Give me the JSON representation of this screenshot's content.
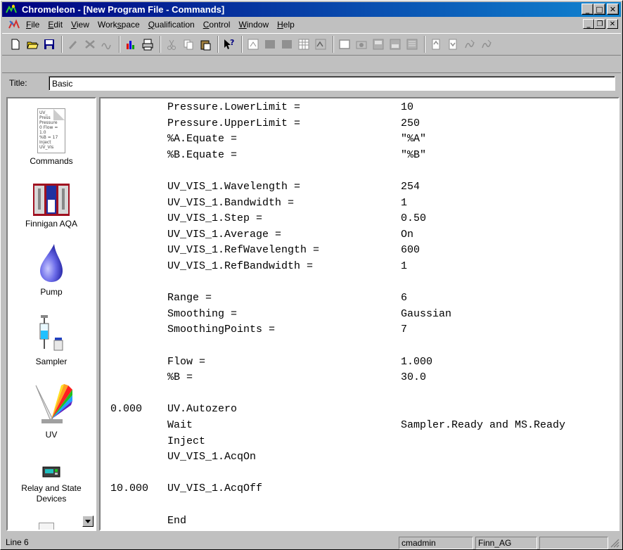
{
  "window": {
    "title": "Chromeleon - [New Program File - Commands]",
    "caption_buttons": [
      "_",
      "□",
      "✕"
    ],
    "mdi_buttons": [
      "_",
      "❐",
      "✕"
    ]
  },
  "menu": [
    {
      "label": "File",
      "u": "F",
      "rest": "ile"
    },
    {
      "label": "Edit",
      "u": "E",
      "rest": "dit"
    },
    {
      "label": "View",
      "u": "V",
      "rest": "iew"
    },
    {
      "label": "Workspace",
      "u": "W",
      "rest": "orkspace",
      "pre": "Work",
      "ul": "s",
      "post": "pace"
    },
    {
      "label": "Qualification",
      "u": "Q",
      "rest": "ualification"
    },
    {
      "label": "Control",
      "u": "C",
      "rest": "ontrol"
    },
    {
      "label": "Window",
      "u": "W",
      "rest": "indow"
    },
    {
      "label": "Help",
      "u": "H",
      "rest": "elp"
    }
  ],
  "toolbar": {
    "icons": [
      "new-icon",
      "open-icon",
      "save-icon",
      "sep",
      "edit-icon",
      "delete-icon",
      "signal-icon",
      "sep",
      "chart-icon",
      "print-icon",
      "sep",
      "cut-icon",
      "copy-icon",
      "paste-icon",
      "sep",
      "help-icon",
      "sep",
      "grid-icon",
      "filled-box-icon",
      "filled-box-icon-2",
      "table-icon",
      "image-icon",
      "sep",
      "frame-icon",
      "camera-icon",
      "panel-icon",
      "panel-icon-2",
      "panel-icon-3",
      "sep",
      "doc-up-icon",
      "doc-down-icon",
      "sign-icon",
      "sign-icon-2"
    ]
  },
  "title_field": {
    "label": "Title:",
    "value": "Basic"
  },
  "sidebar": {
    "items": [
      {
        "label": "Commands",
        "icon": "document-icon"
      },
      {
        "label": "Finnigan AQA",
        "icon": "mass-spec-icon"
      },
      {
        "label": "Pump",
        "icon": "droplet-icon"
      },
      {
        "label": "Sampler",
        "icon": "syringe-icon"
      },
      {
        "label": "UV",
        "icon": "uv-spectrum-icon"
      },
      {
        "label": "Relay and State\nDevices",
        "label1": "Relay and State",
        "label2": "Devices",
        "icon": "relay-icon"
      }
    ],
    "commands_thumb": [
      "UV_",
      "Press",
      "Pressure",
      "0 Flow = 1.0",
      "%B = 17",
      "Inject",
      "UV_Vis"
    ]
  },
  "editor": {
    "lines": [
      {
        "time": "",
        "cmd": "Pressure.LowerLimit =",
        "val": "10"
      },
      {
        "time": "",
        "cmd": "Pressure.UpperLimit =",
        "val": "250"
      },
      {
        "time": "",
        "cmd": "%A.Equate =",
        "val": "\"%A\""
      },
      {
        "time": "",
        "cmd": "%B.Equate =",
        "val": "\"%B\""
      },
      {
        "time": "",
        "cmd": "",
        "val": ""
      },
      {
        "time": "",
        "cmd": "UV_VIS_1.Wavelength =",
        "val": "254"
      },
      {
        "time": "",
        "cmd": "UV_VIS_1.Bandwidth =",
        "val": "1"
      },
      {
        "time": "",
        "cmd": "UV_VIS_1.Step =",
        "val": "0.50"
      },
      {
        "time": "",
        "cmd": "UV_VIS_1.Average =",
        "val": "On"
      },
      {
        "time": "",
        "cmd": "UV_VIS_1.RefWavelength =",
        "val": "600"
      },
      {
        "time": "",
        "cmd": "UV_VIS_1.RefBandwidth =",
        "val": "1"
      },
      {
        "time": "",
        "cmd": "",
        "val": ""
      },
      {
        "time": "",
        "cmd": "Range =",
        "val": "6"
      },
      {
        "time": "",
        "cmd": "Smoothing =",
        "val": "Gaussian"
      },
      {
        "time": "",
        "cmd": "SmoothingPoints =",
        "val": "7"
      },
      {
        "time": "",
        "cmd": "",
        "val": ""
      },
      {
        "time": "",
        "cmd": "Flow =",
        "val": "1.000"
      },
      {
        "time": "",
        "cmd": "%B =",
        "val": "30.0"
      },
      {
        "time": "",
        "cmd": "",
        "val": ""
      },
      {
        "time": "0.000",
        "cmd": "UV.Autozero",
        "val": ""
      },
      {
        "time": "",
        "cmd": "Wait",
        "val": "Sampler.Ready and MS.Ready"
      },
      {
        "time": "",
        "cmd": "Inject",
        "val": ""
      },
      {
        "time": "",
        "cmd": "UV_VIS_1.AcqOn",
        "val": ""
      },
      {
        "time": "",
        "cmd": "",
        "val": ""
      },
      {
        "time": "10.000",
        "cmd": "UV_VIS_1.AcqOff",
        "val": ""
      },
      {
        "time": "",
        "cmd": "",
        "val": ""
      },
      {
        "time": "",
        "cmd": "End",
        "val": ""
      }
    ]
  },
  "status": {
    "position": "Line 6",
    "user": "cmadmin",
    "server": "Finn_AG",
    "extra": ""
  },
  "colors": {
    "titlebar_start": "#000080",
    "titlebar_end": "#1084d0",
    "face": "#c0c0c0"
  }
}
